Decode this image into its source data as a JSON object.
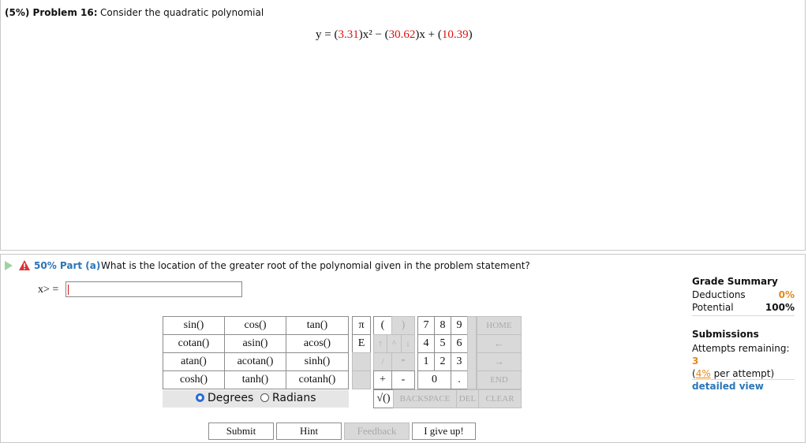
{
  "problem": {
    "label": "(5%) Problem 16:",
    "text": "Consider the quadratic polynomial",
    "equation": {
      "lhs": "y = (",
      "a": "3.31",
      "mid1": ")x² − (",
      "b": "30.62",
      "mid2": ")x + (",
      "c": "10.39",
      "end": ")"
    }
  },
  "part": {
    "label": "50% Part (a)",
    "question": "What is the location of the greater root of the polynomial given in the problem statement?",
    "answer_label": "x> =",
    "answer_value": ""
  },
  "keypad": {
    "functions": [
      [
        "sin()",
        "cos()",
        "tan()"
      ],
      [
        "cotan()",
        "asin()",
        "acos()"
      ],
      [
        "atan()",
        "acotan()",
        "sinh()"
      ],
      [
        "cosh()",
        "tanh()",
        "cotanh()"
      ]
    ],
    "degrees": "Degrees",
    "radians": "Radians",
    "angle_mode": "Degrees",
    "pi": "π",
    "e": "E",
    "lparen": "(",
    "rparen": ")",
    "up": "↑",
    "caret": "^",
    "down": "↓",
    "slash": "/",
    "star": "*",
    "plus": "+",
    "minus": "-",
    "sqrt": "√()",
    "digits": [
      "7",
      "8",
      "9",
      "4",
      "5",
      "6",
      "1",
      "2",
      "3"
    ],
    "zero": "0",
    "dot": ".",
    "home": "HOME",
    "back_arrow": "←",
    "fwd_arrow": "→",
    "end": "END",
    "backspace": "BACKSPACE",
    "del": "DEL",
    "clear": "CLEAR"
  },
  "buttons": {
    "submit": "Submit",
    "hint": "Hint",
    "feedback": "Feedback",
    "give_up": "I give up!"
  },
  "grade": {
    "title": "Grade Summary",
    "deductions_label": "Deductions",
    "deductions_value": "0%",
    "potential_label": "Potential",
    "potential_value": "100%"
  },
  "submissions": {
    "title": "Submissions",
    "attempts_label": "Attempts remaining:",
    "attempts_value": "3",
    "per_attempt_pct": "4%",
    "per_attempt_suffix": "per attempt)",
    "per_attempt_prefix": "(",
    "detailed_view": "detailed view"
  },
  "colors": {
    "accent_blue": "#2a75b8",
    "accent_orange": "#e28a1a",
    "equation_red": "#d11"
  }
}
